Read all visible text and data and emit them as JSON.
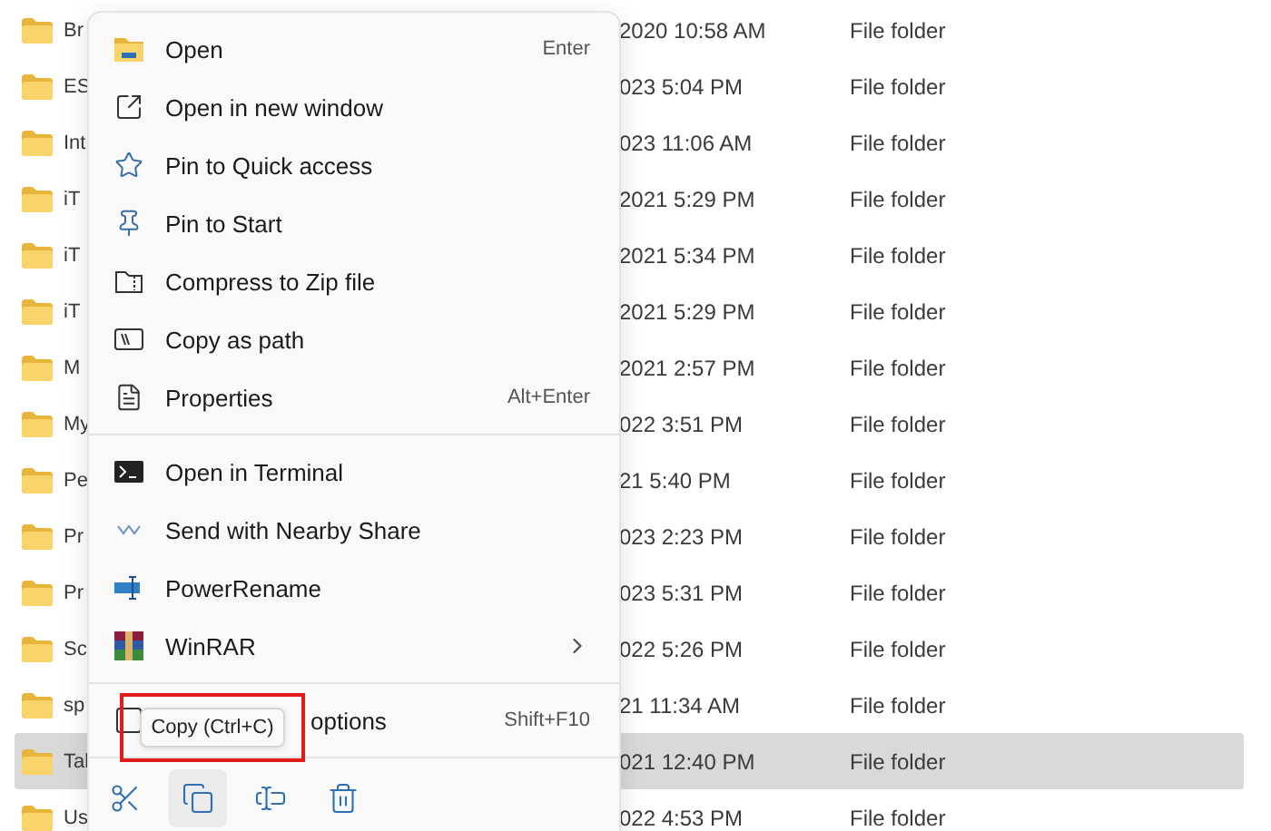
{
  "files": [
    {
      "name": "Br",
      "modified": "2020 10:58 AM",
      "type": "File folder",
      "selected": false
    },
    {
      "name": "ES",
      "modified": "023 5:04 PM",
      "type": "File folder",
      "selected": false
    },
    {
      "name": "Int",
      "modified": "023 11:06 AM",
      "type": "File folder",
      "selected": false
    },
    {
      "name": "iT",
      "modified": "2021 5:29 PM",
      "type": "File folder",
      "selected": false
    },
    {
      "name": "iT",
      "modified": "2021 5:34 PM",
      "type": "File folder",
      "selected": false
    },
    {
      "name": "iT",
      "modified": "2021 5:29 PM",
      "type": "File folder",
      "selected": false
    },
    {
      "name": "M",
      "modified": "2021 2:57 PM",
      "type": "File folder",
      "selected": false
    },
    {
      "name": "My",
      "modified": "022 3:51 PM",
      "type": "File folder",
      "selected": false
    },
    {
      "name": "Pe",
      "modified": "21 5:40 PM",
      "type": "File folder",
      "selected": false
    },
    {
      "name": "Pr",
      "modified": "023 2:23 PM",
      "type": "File folder",
      "selected": false
    },
    {
      "name": "Pr",
      "modified": "023 5:31 PM",
      "type": "File folder",
      "selected": false
    },
    {
      "name": "Sc",
      "modified": "022 5:26 PM",
      "type": "File folder",
      "selected": false
    },
    {
      "name": "sp",
      "modified": "21 11:34 AM",
      "type": "File folder",
      "selected": false
    },
    {
      "name": "Tal",
      "modified": "021 12:40 PM",
      "type": "File folder",
      "selected": true
    },
    {
      "name": "Us",
      "modified": "022 4:53 PM",
      "type": "File folder",
      "selected": false
    }
  ],
  "context_menu": {
    "sections": [
      [
        {
          "label": "Open",
          "shortcut": "Enter"
        },
        {
          "label": "Open in new window"
        },
        {
          "label": "Pin to Quick access"
        },
        {
          "label": "Pin to Start"
        },
        {
          "label": "Compress to Zip file"
        },
        {
          "label": "Copy as path"
        },
        {
          "label": "Properties",
          "shortcut": "Alt+Enter"
        }
      ],
      [
        {
          "label": "Open in Terminal"
        },
        {
          "label": "Send with Nearby Share"
        },
        {
          "label": "PowerRename"
        },
        {
          "label": "WinRAR",
          "submenu": true
        }
      ],
      [
        {
          "label": "options",
          "shortcut": "Shift+F10",
          "kind": "covered"
        }
      ]
    ],
    "toolbar": [
      {
        "hovered": false
      },
      {
        "hovered": true
      },
      {
        "hovered": false
      },
      {
        "hovered": false
      }
    ],
    "tooltip": {
      "text": "Copy (Ctrl+C)",
      "highlighted": true
    }
  }
}
